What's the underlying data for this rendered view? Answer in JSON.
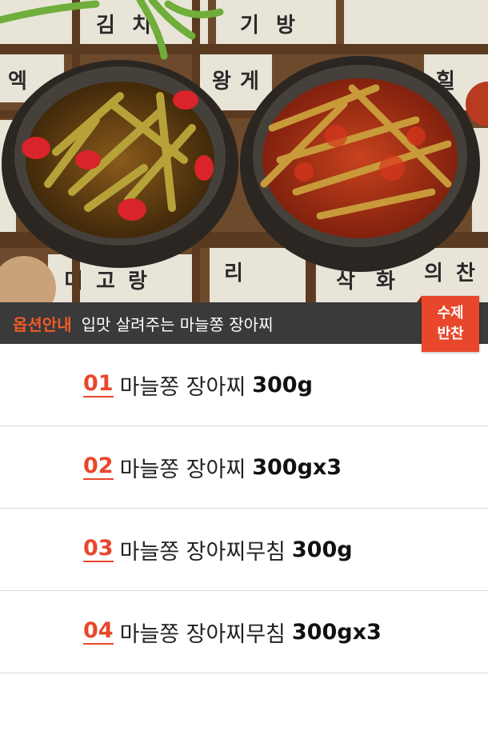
{
  "hero": {
    "image_name": "garlic-stem-pickle-bowls-photo",
    "background_hangul": [
      "김",
      "치",
      "기",
      "방",
      "왕",
      "게",
      "힐",
      "엑",
      "미",
      "고",
      "랑",
      "리",
      "삭",
      "화",
      "의",
      "찬"
    ]
  },
  "bar": {
    "option_label": "옵션안내",
    "description": "입맛 살려주는 마늘쫑 장아찌",
    "badge_line1": "수제",
    "badge_line2": "반찬"
  },
  "options": [
    {
      "num": "01",
      "name": "마늘쫑 장아찌",
      "qty": "300g"
    },
    {
      "num": "02",
      "name": "마늘쫑 장아찌",
      "qty": "300gx3"
    },
    {
      "num": "03",
      "name": "마늘쫑 장아찌무침",
      "qty": "300g"
    },
    {
      "num": "04",
      "name": "마늘쫑 장아찌무침",
      "qty": "300gx3"
    }
  ],
  "colors": {
    "accent": "#e8472b",
    "bar_bg": "#3a3a3a",
    "divider": "#d9d9d9"
  }
}
